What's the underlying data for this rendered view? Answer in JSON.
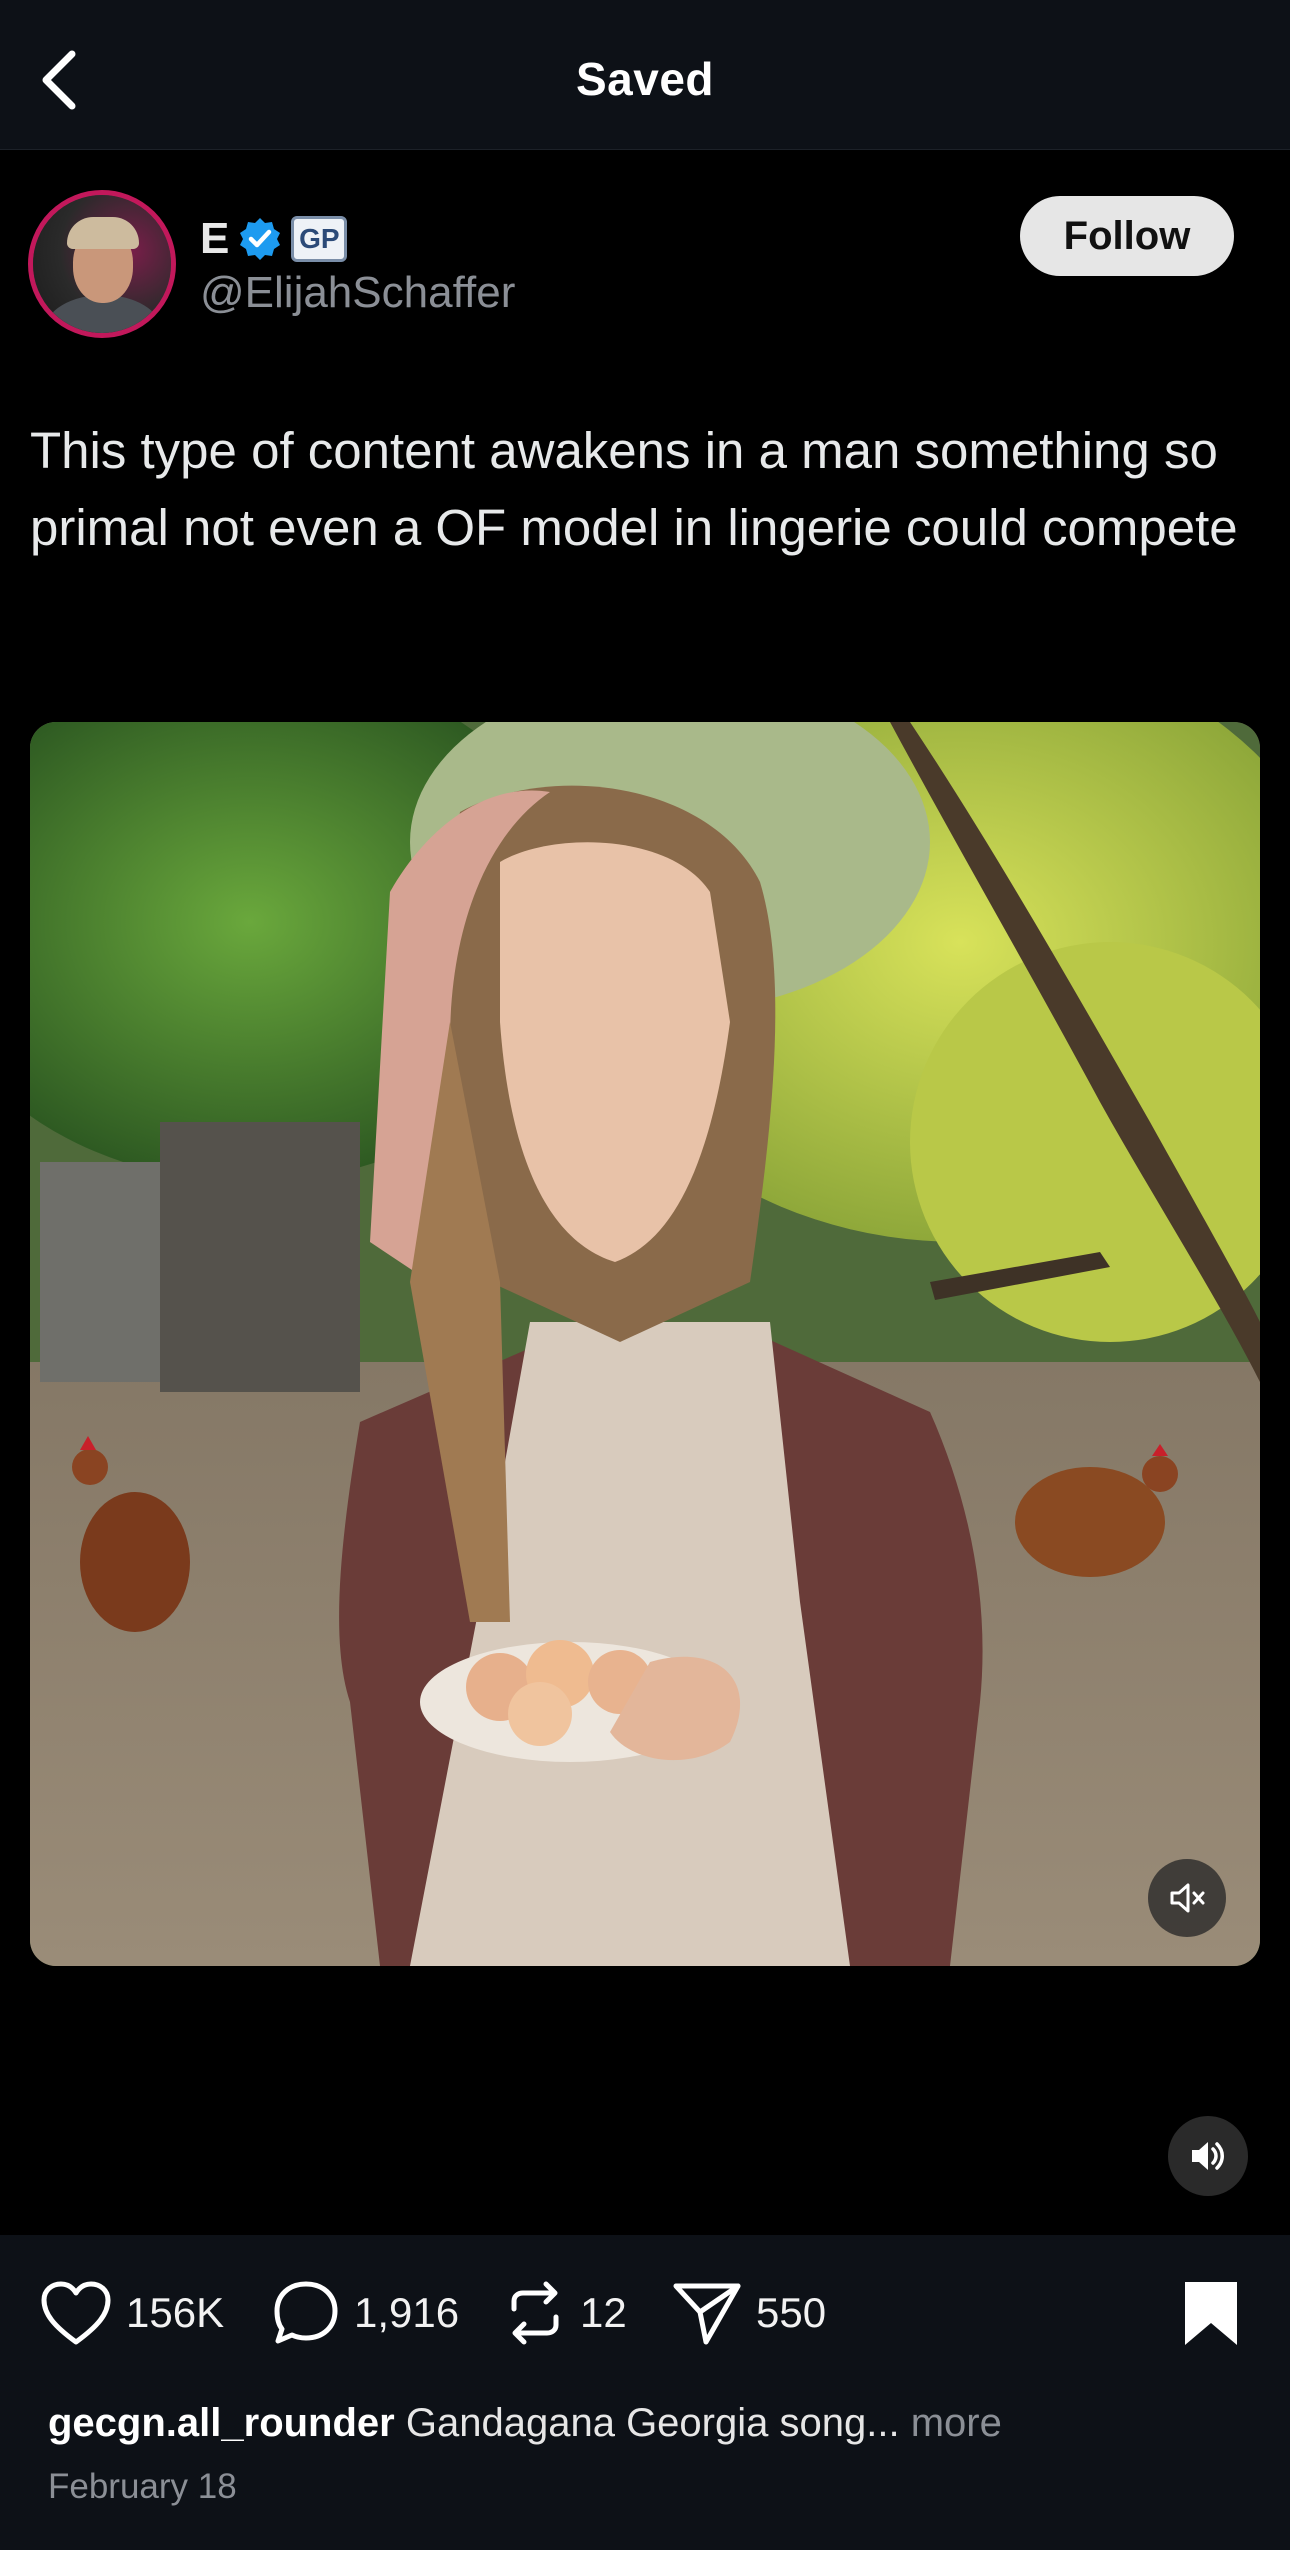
{
  "header": {
    "title": "Saved"
  },
  "post": {
    "author": {
      "name": "E",
      "badge": "GP",
      "handle": "@ElijahSchaffer"
    },
    "follow_label": "Follow",
    "text": "This type of content awakens in a man something so primal not even a OF model in lingerie could compete"
  },
  "actions": {
    "likes": "156K",
    "comments": "1,916",
    "reposts": "12",
    "shares": "550"
  },
  "caption": {
    "username": "gecgn.all_rounder",
    "text": "Gandagana Georgia song...",
    "more": "more",
    "date": "February 18"
  },
  "colors": {
    "avatar_ring": "#c2185b",
    "verified": "#1d9bf0",
    "top_bar": "#0d1117",
    "follow_bg": "#e6e6e6"
  },
  "icons": {
    "back": "chevron-left-icon",
    "verified": "verified-check-icon",
    "mute": "speaker-muted-icon",
    "volume": "speaker-on-icon",
    "like": "heart-icon",
    "comment": "speech-bubble-icon",
    "repost": "repost-arrows-icon",
    "share": "paper-plane-icon",
    "bookmark": "bookmark-icon"
  }
}
